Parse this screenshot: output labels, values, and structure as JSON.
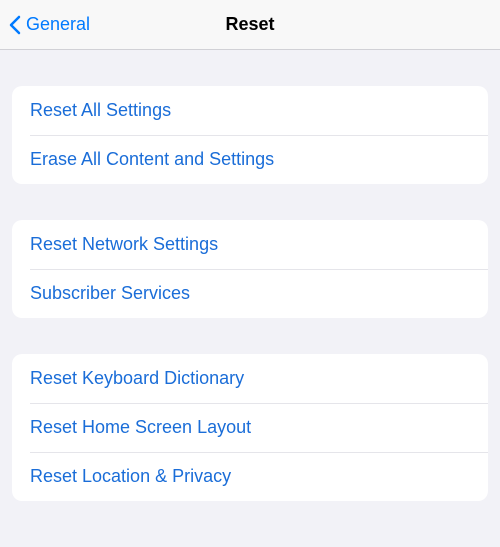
{
  "header": {
    "back_label": "General",
    "title": "Reset"
  },
  "groups": [
    {
      "items": [
        {
          "label": "Reset All Settings"
        },
        {
          "label": "Erase All Content and Settings"
        }
      ]
    },
    {
      "items": [
        {
          "label": "Reset Network Settings"
        },
        {
          "label": "Subscriber Services"
        }
      ]
    },
    {
      "items": [
        {
          "label": "Reset Keyboard Dictionary"
        },
        {
          "label": "Reset Home Screen Layout"
        },
        {
          "label": "Reset Location & Privacy"
        }
      ]
    }
  ]
}
